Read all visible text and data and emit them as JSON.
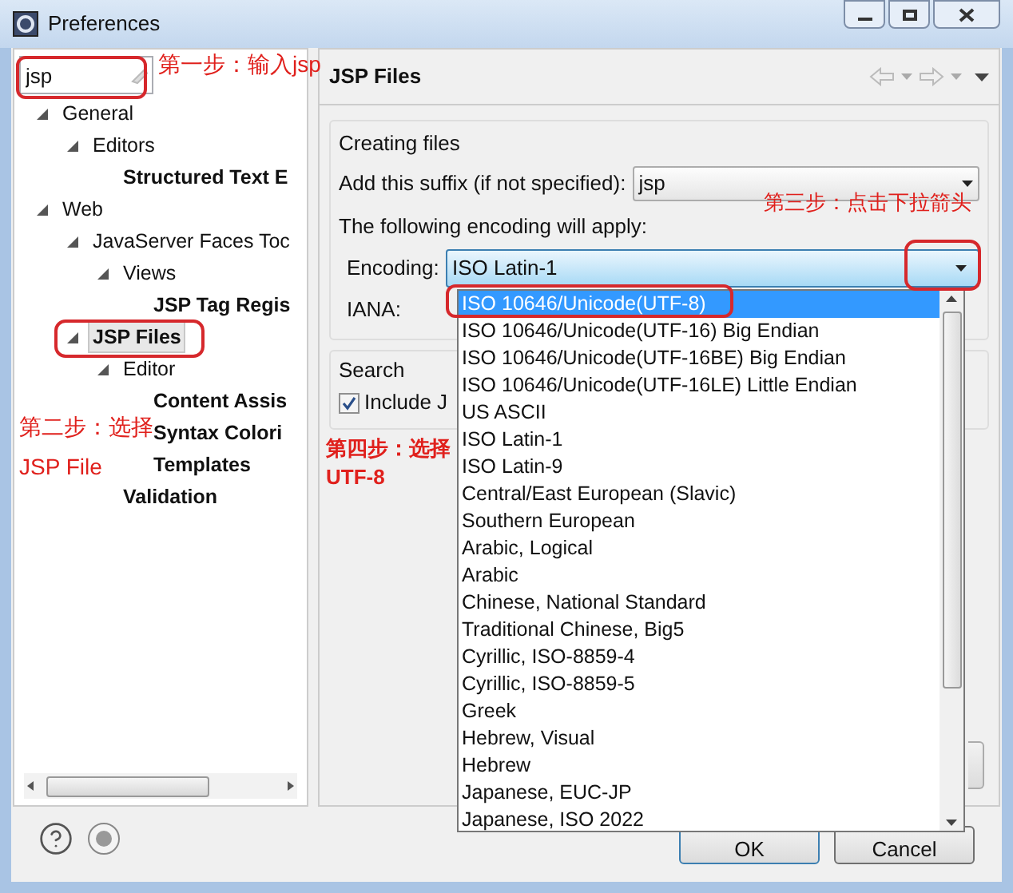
{
  "window": {
    "title": "Preferences"
  },
  "filter": {
    "value": "jsp"
  },
  "tree": [
    {
      "label": "General",
      "match": false,
      "selected": false,
      "expanded": true,
      "children": [
        {
          "label": "Editors",
          "match": false,
          "selected": false,
          "expanded": true,
          "children": [
            {
              "label": "Structured Text E",
              "match": true,
              "selected": false
            }
          ]
        }
      ]
    },
    {
      "label": "Web",
      "match": false,
      "selected": false,
      "expanded": true,
      "children": [
        {
          "label": "JavaServer Faces Toc",
          "match": false,
          "selected": false,
          "expanded": true,
          "children": [
            {
              "label": "Views",
              "match": false,
              "selected": false,
              "expanded": true,
              "children": [
                {
                  "label": "JSP Tag Regis",
                  "match": true,
                  "selected": false
                }
              ]
            }
          ]
        },
        {
          "label": "JSP Files",
          "match": true,
          "selected": true,
          "expanded": true,
          "children": [
            {
              "label": "Editor",
              "match": false,
              "selected": false,
              "expanded": true,
              "children": [
                {
                  "label": "Content Assis",
                  "match": true,
                  "selected": false
                },
                {
                  "label": "Syntax Colori",
                  "match": true,
                  "selected": false
                },
                {
                  "label": "Templates",
                  "match": true,
                  "selected": false
                }
              ]
            },
            {
              "label": "Validation",
              "match": true,
              "selected": false
            }
          ]
        }
      ]
    }
  ],
  "page": {
    "title": "JSP Files",
    "creating_files": {
      "title": "Creating files",
      "suffix_label": "Add this suffix (if not specified):",
      "suffix_value": "jsp",
      "encoding_note": "The following encoding will apply:",
      "encoding_label": "Encoding:",
      "encoding_value": "ISO Latin-1",
      "iana_label": "IANA:"
    },
    "search": {
      "title": "Search",
      "include_label": "Include J",
      "include_checked": true
    }
  },
  "encoding_list": [
    {
      "label": "ISO 10646/Unicode(UTF-8)",
      "selected": true
    },
    {
      "label": "ISO 10646/Unicode(UTF-16) Big Endian",
      "selected": false
    },
    {
      "label": "ISO 10646/Unicode(UTF-16BE) Big Endian",
      "selected": false
    },
    {
      "label": "ISO 10646/Unicode(UTF-16LE) Little Endian",
      "selected": false
    },
    {
      "label": "US ASCII",
      "selected": false
    },
    {
      "label": "ISO Latin-1",
      "selected": false
    },
    {
      "label": "ISO Latin-9",
      "selected": false
    },
    {
      "label": "Central/East European (Slavic)",
      "selected": false
    },
    {
      "label": "Southern European",
      "selected": false
    },
    {
      "label": "Arabic, Logical",
      "selected": false
    },
    {
      "label": "Arabic",
      "selected": false
    },
    {
      "label": "Chinese, National Standard",
      "selected": false
    },
    {
      "label": "Traditional Chinese, Big5",
      "selected": false
    },
    {
      "label": "Cyrillic, ISO-8859-4",
      "selected": false
    },
    {
      "label": "Cyrillic, ISO-8859-5",
      "selected": false
    },
    {
      "label": "Greek",
      "selected": false
    },
    {
      "label": "Hebrew, Visual",
      "selected": false
    },
    {
      "label": "Hebrew",
      "selected": false
    },
    {
      "label": "Japanese, EUC-JP",
      "selected": false
    },
    {
      "label": "Japanese, ISO 2022",
      "selected": false
    }
  ],
  "buttons": [
    {
      "label": "OK",
      "default": true
    },
    {
      "label": "Cancel",
      "default": false
    }
  ],
  "annotations": [
    {
      "text": "第一步：输入jsp"
    },
    {
      "text": "第二步：选择"
    },
    {
      "text": "JSP File"
    },
    {
      "text": "第三步：点击下拉箭头"
    },
    {
      "text": "第四步：选择UTF-8"
    }
  ]
}
